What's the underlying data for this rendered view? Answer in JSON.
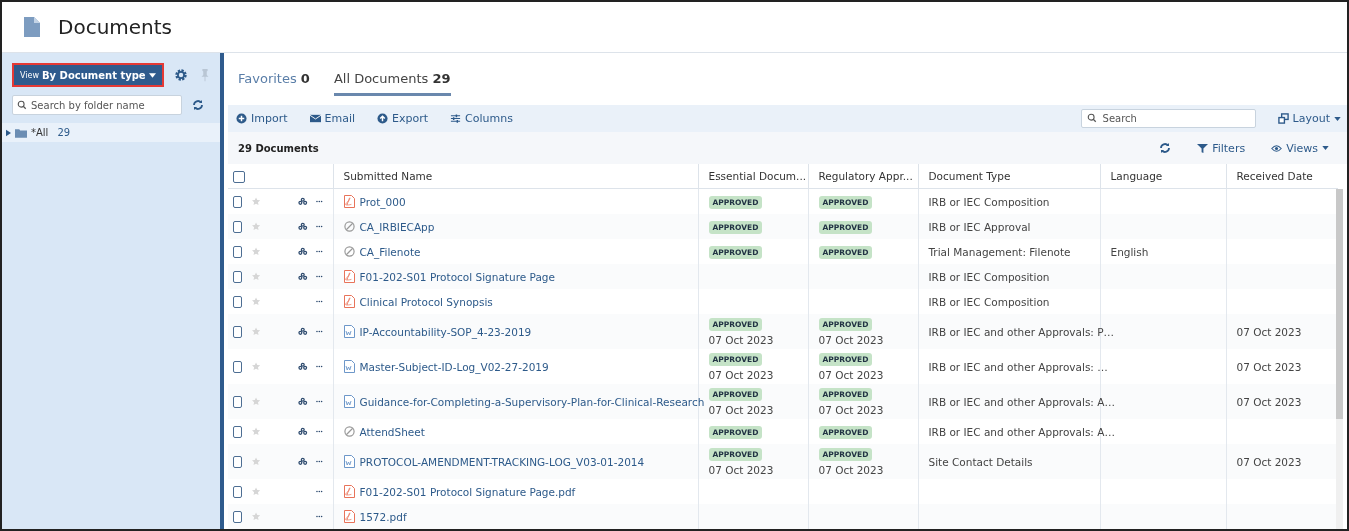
{
  "page_title": "Documents",
  "sidebar": {
    "view_button": {
      "prefix": "View",
      "label": "By Document type"
    },
    "search": {
      "placeholder": "Search by folder name"
    },
    "tree": [
      {
        "label": "*All",
        "count": "29",
        "expanded": false
      }
    ]
  },
  "tabs": [
    {
      "label": "Favorites",
      "count": "0",
      "selected": false
    },
    {
      "label": "All Documents",
      "count": "29",
      "selected": true
    }
  ],
  "toolbar": {
    "actions": [
      {
        "kind": "import",
        "label": "Import"
      },
      {
        "kind": "email",
        "label": "Email"
      },
      {
        "kind": "export",
        "label": "Export"
      },
      {
        "kind": "columns",
        "label": "Columns"
      }
    ],
    "search": {
      "placeholder": "Search"
    },
    "layout": "Layout"
  },
  "summary": {
    "count": "29 Documents",
    "filters": "Filters",
    "views": "Views"
  },
  "table": {
    "select_all_checked": false,
    "columns": [
      "Submitted Name",
      "Essential Docum...",
      "Regulatory Appr...",
      "Document Type",
      "Language",
      "Received Date"
    ],
    "rows": [
      {
        "checked": false,
        "starred": false,
        "linked": true,
        "kind": "pdf",
        "name": "Prot_000",
        "essential": {
          "status": "APPROVED"
        },
        "regulatory": {
          "status": "APPROVED"
        },
        "document_type": "IRB or IEC Composition"
      },
      {
        "checked": false,
        "starred": false,
        "linked": true,
        "kind": "none",
        "name": "CA_IRBIECApp",
        "essential": {
          "status": "APPROVED"
        },
        "regulatory": {
          "status": "APPROVED"
        },
        "document_type": "IRB or IEC Approval"
      },
      {
        "checked": false,
        "starred": false,
        "linked": true,
        "kind": "none",
        "name": "CA_Filenote",
        "essential": {
          "status": "APPROVED"
        },
        "regulatory": {
          "status": "APPROVED"
        },
        "document_type": "Trial Management: Filenote",
        "language": "English"
      },
      {
        "checked": false,
        "starred": false,
        "linked": true,
        "kind": "pdf",
        "name": "F01-202-S01 Protocol Signature Page",
        "document_type": "IRB or IEC Composition"
      },
      {
        "checked": false,
        "starred": false,
        "linked": false,
        "kind": "pdf",
        "name": "Clinical Protocol Synopsis",
        "document_type": "IRB or IEC Composition"
      },
      {
        "checked": false,
        "starred": false,
        "linked": true,
        "kind": "word",
        "name": "IP-Accountability-SOP_4-23-2019",
        "essential": {
          "status": "APPROVED",
          "date": "07 Oct 2023"
        },
        "regulatory": {
          "status": "APPROVED",
          "date": "07 Oct 2023"
        },
        "document_type": "IRB or IEC and other Approvals: P…",
        "received_date": "07 Oct 2023"
      },
      {
        "checked": false,
        "starred": false,
        "linked": true,
        "kind": "word",
        "name": "Master-Subject-ID-Log_V02-27-2019",
        "essential": {
          "status": "APPROVED",
          "date": "07 Oct 2023"
        },
        "regulatory": {
          "status": "APPROVED",
          "date": "07 Oct 2023"
        },
        "document_type": "IRB or IEC and other Approvals: …",
        "received_date": "07 Oct 2023"
      },
      {
        "checked": false,
        "starred": false,
        "linked": true,
        "kind": "word",
        "name": "Guidance-for-Completing-a-Supervisory-Plan-for-Clinical-Research",
        "essential": {
          "status": "APPROVED",
          "date": "07 Oct 2023"
        },
        "regulatory": {
          "status": "APPROVED",
          "date": "07 Oct 2023"
        },
        "document_type": "IRB or IEC and other Approvals: A…",
        "received_date": "07 Oct 2023"
      },
      {
        "checked": false,
        "starred": false,
        "linked": true,
        "kind": "none",
        "name": "AttendSheet",
        "essential": {
          "status": "APPROVED"
        },
        "regulatory": {
          "status": "APPROVED"
        },
        "document_type": "IRB or IEC and other Approvals: A…"
      },
      {
        "checked": false,
        "starred": false,
        "linked": true,
        "kind": "word",
        "name": "PROTOCOL-AMENDMENT-TRACKING-LOG_V03-01-2014",
        "essential": {
          "status": "APPROVED",
          "date": "07 Oct 2023"
        },
        "regulatory": {
          "status": "APPROVED",
          "date": "07 Oct 2023"
        },
        "document_type": "Site Contact Details",
        "received_date": "07 Oct 2023"
      },
      {
        "checked": false,
        "starred": false,
        "linked": false,
        "kind": "pdf",
        "name": "F01-202-S01 Protocol Signature Page.pdf"
      },
      {
        "checked": false,
        "starred": false,
        "linked": false,
        "kind": "pdf",
        "name": "1572.pdf"
      }
    ]
  }
}
